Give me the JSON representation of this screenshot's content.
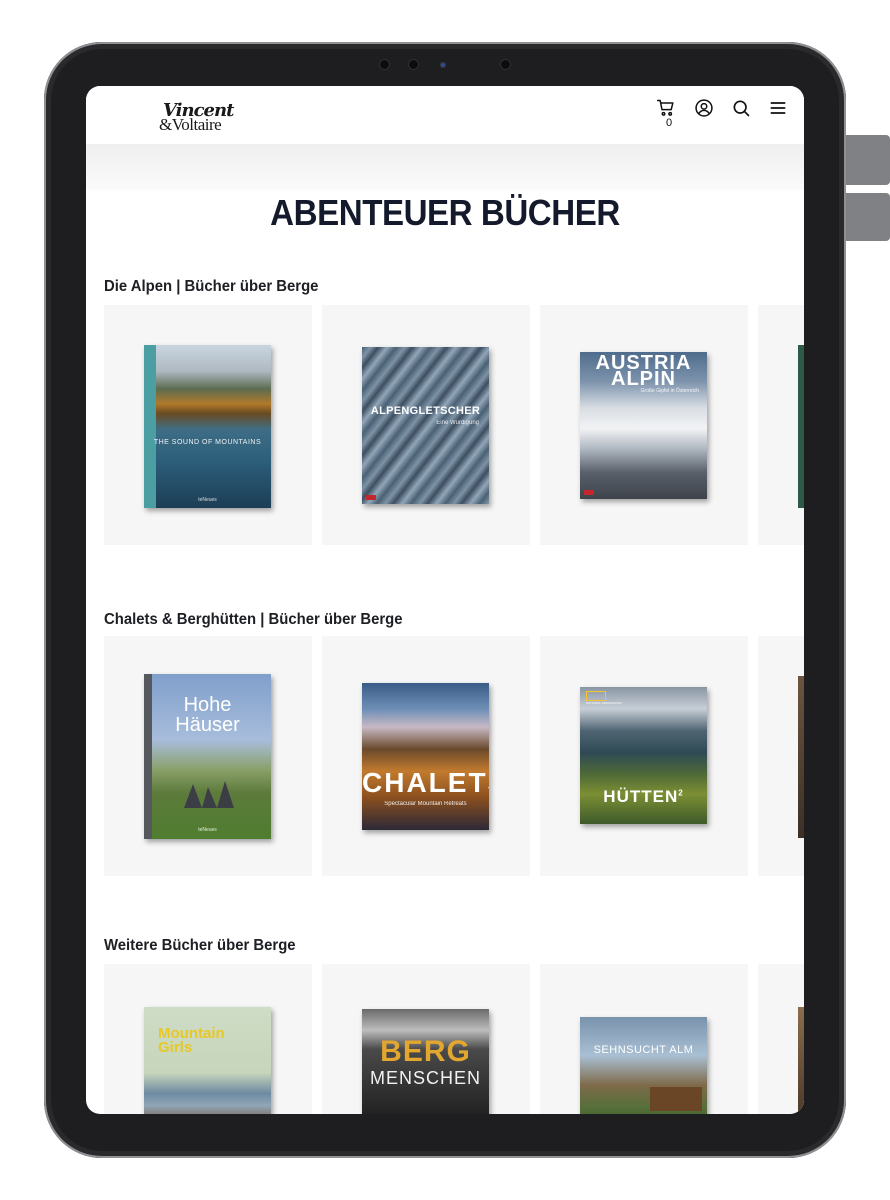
{
  "header": {
    "logo_line1": "Vincent",
    "logo_line2": "&Voltaire",
    "cart_count": "0",
    "icons": [
      "cart-icon",
      "account-icon",
      "search-icon",
      "menu-icon"
    ]
  },
  "page_title": "ABENTEUER BÜCHER",
  "sections": [
    {
      "title": "Die Alpen | Bücher über Berge",
      "books": [
        {
          "title": "THE SOUND OF MOUNTAINS",
          "publisher": "teNeues"
        },
        {
          "title": "ALPENGLETSCHER",
          "subtitle": "Eine Würdigung"
        },
        {
          "title": "AUSTRIA ALPIN",
          "subtitle": "Große Gipfel in Österreich"
        }
      ]
    },
    {
      "title": "Chalets & Berghütten | Bücher über Berge",
      "books": [
        {
          "title_line1": "Hohe",
          "title_line2": "Häuser",
          "publisher": "teNeues"
        },
        {
          "title": "CHALETS",
          "subtitle": "Spectacular Mountain Retreats"
        },
        {
          "title": "HÜTTEN",
          "title_sup": "2",
          "brand": "NATIONAL GEOGRAPHIC"
        }
      ]
    },
    {
      "title": "Weitere Bücher über Berge",
      "books": [
        {
          "title_line1": "Mountain",
          "title_line2": "Girls"
        },
        {
          "title_line1": "BERG",
          "title_line2": "MENSCHEN"
        },
        {
          "title": "SEHNSUCHT ALM"
        }
      ]
    }
  ],
  "colors": {
    "title": "#141a2b",
    "card_bg": "#f6f6f6",
    "device_frame": "#1e1e21"
  }
}
